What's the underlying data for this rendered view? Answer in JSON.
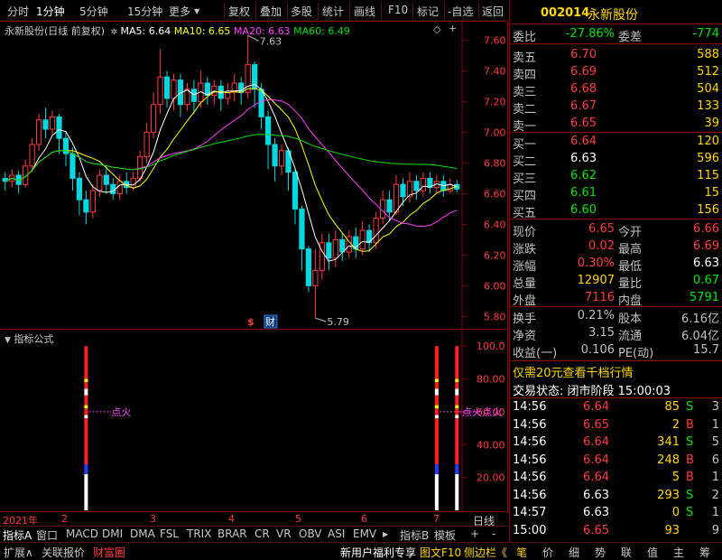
{
  "toolbar": {
    "left": [
      "分时",
      "1分钟",
      "5分钟",
      "15分钟",
      "更多"
    ],
    "more_icon": "chevron-down-icon",
    "right": [
      "复权",
      "叠加",
      "多股",
      "统计",
      "画线",
      "F10",
      "标记",
      "-自选",
      "返回"
    ]
  },
  "chart_header": {
    "title": "永新股份(日线 前复权)",
    "ma5": "MA5: 6.64",
    "ma10": "MA10: 6.65",
    "ma20": "MA20: 6.63",
    "ma60": "MA60: 6.49"
  },
  "colors": {
    "up": "#ff3c3c",
    "down": "#00d8e0",
    "ma5": "#ffffff",
    "ma10": "#ffff00",
    "ma20": "#ff40ff",
    "ma60": "#00e000",
    "border": "#8b0000"
  },
  "chart_data": [
    {
      "type": "candlestick",
      "ylim": [
        5.72,
        7.72
      ],
      "yticks": [
        "7.60",
        "7.40",
        "7.20",
        "7.00",
        "6.80",
        "6.60",
        "6.40",
        "6.20",
        "6.00",
        "5.80"
      ],
      "ytick_values": [
        7.6,
        7.4,
        7.2,
        7.0,
        6.8,
        6.6,
        6.4,
        6.2,
        6.0,
        5.8
      ],
      "annotations": {
        "high": "7.63",
        "low": "5.79",
        "high_value": 7.63,
        "low_value": 5.79
      },
      "markers": [
        "$",
        "财"
      ],
      "candles": [
        [
          6.7,
          6.68,
          6.74,
          6.62
        ],
        [
          6.68,
          6.72,
          6.76,
          6.64
        ],
        [
          6.72,
          6.66,
          6.75,
          6.6
        ],
        [
          6.66,
          6.78,
          6.82,
          6.64
        ],
        [
          6.78,
          6.92,
          6.96,
          6.74
        ],
        [
          6.92,
          7.08,
          7.12,
          6.88
        ],
        [
          7.08,
          7.02,
          7.16,
          6.96
        ],
        [
          7.02,
          7.1,
          7.14,
          6.98
        ],
        [
          7.1,
          6.96,
          7.12,
          6.86
        ],
        [
          6.96,
          6.86,
          7.0,
          6.78
        ],
        [
          6.86,
          6.7,
          6.9,
          6.62
        ],
        [
          6.7,
          6.56,
          6.74,
          6.46
        ],
        [
          6.56,
          6.48,
          6.62,
          6.4
        ],
        [
          6.48,
          6.62,
          6.66,
          6.44
        ],
        [
          6.62,
          6.72,
          6.76,
          6.58
        ],
        [
          6.72,
          6.66,
          6.78,
          6.6
        ],
        [
          6.66,
          6.6,
          6.7,
          6.56
        ],
        [
          6.6,
          6.68,
          6.72,
          6.56
        ],
        [
          6.68,
          6.64,
          6.74,
          6.6
        ],
        [
          6.64,
          6.7,
          6.74,
          6.62
        ],
        [
          6.7,
          6.84,
          6.88,
          6.68
        ],
        [
          6.84,
          7.0,
          7.06,
          6.8
        ],
        [
          7.0,
          7.18,
          7.26,
          6.96
        ],
        [
          7.18,
          7.36,
          7.54,
          7.12
        ],
        [
          7.36,
          7.22,
          7.4,
          7.16
        ],
        [
          7.22,
          7.34,
          7.38,
          7.14
        ],
        [
          7.34,
          7.18,
          7.38,
          7.1
        ],
        [
          7.18,
          7.28,
          7.32,
          7.14
        ],
        [
          7.28,
          7.2,
          7.34,
          7.12
        ],
        [
          7.2,
          7.32,
          7.4,
          7.16
        ],
        [
          7.32,
          7.24,
          7.36,
          7.18
        ],
        [
          7.24,
          7.3,
          7.34,
          7.18
        ],
        [
          7.3,
          7.22,
          7.34,
          7.14
        ],
        [
          7.22,
          7.26,
          7.32,
          7.18
        ],
        [
          7.26,
          7.32,
          7.38,
          7.2
        ],
        [
          7.32,
          7.26,
          7.36,
          7.18
        ],
        [
          7.26,
          7.44,
          7.63,
          7.22
        ],
        [
          7.44,
          7.28,
          7.46,
          7.16
        ],
        [
          7.28,
          7.1,
          7.32,
          7.02
        ],
        [
          7.1,
          6.92,
          7.14,
          6.76
        ],
        [
          6.92,
          6.78,
          6.96,
          6.68
        ],
        [
          6.78,
          6.88,
          6.92,
          6.72
        ],
        [
          6.88,
          6.74,
          6.9,
          6.62
        ],
        [
          6.74,
          6.5,
          6.76,
          6.4
        ],
        [
          6.5,
          6.24,
          6.52,
          6.1
        ],
        [
          6.24,
          6.0,
          6.26,
          5.96
        ],
        [
          6.0,
          6.1,
          6.24,
          5.79
        ],
        [
          6.1,
          6.28,
          6.34,
          6.04
        ],
        [
          6.28,
          6.18,
          6.34,
          6.1
        ],
        [
          6.18,
          6.3,
          6.36,
          6.12
        ],
        [
          6.3,
          6.22,
          6.34,
          6.16
        ],
        [
          6.22,
          6.32,
          6.36,
          6.18
        ],
        [
          6.32,
          6.24,
          6.38,
          6.18
        ],
        [
          6.24,
          6.36,
          6.42,
          6.2
        ],
        [
          6.36,
          6.28,
          6.4,
          6.22
        ],
        [
          6.28,
          6.44,
          6.48,
          6.24
        ],
        [
          6.44,
          6.56,
          6.62,
          6.4
        ],
        [
          6.56,
          6.48,
          6.62,
          6.42
        ],
        [
          6.48,
          6.66,
          6.72,
          6.46
        ],
        [
          6.66,
          6.58,
          6.7,
          6.52
        ],
        [
          6.58,
          6.68,
          6.74,
          6.54
        ],
        [
          6.68,
          6.62,
          6.72,
          6.56
        ],
        [
          6.62,
          6.7,
          6.74,
          6.58
        ],
        [
          6.7,
          6.64,
          6.74,
          6.6
        ],
        [
          6.64,
          6.68,
          6.72,
          6.6
        ],
        [
          6.68,
          6.62,
          6.72,
          6.58
        ],
        [
          6.62,
          6.66,
          6.7,
          6.6
        ],
        [
          6.66,
          6.63,
          6.69,
          6.61
        ]
      ]
    },
    {
      "type": "bar",
      "title": "指标公式",
      "ylim": [
        0,
        110
      ],
      "yticks": [
        "100.0",
        "80.00",
        "60.00",
        "40.00",
        "20.00"
      ],
      "ytick_values": [
        100,
        80,
        60,
        40,
        20
      ],
      "signal_label": "点火",
      "signals": [
        {
          "index": 12,
          "value": 100,
          "label": "点火"
        },
        {
          "index": 64,
          "value": 100,
          "label": "点火"
        },
        {
          "index": 67,
          "value": 100,
          "label": "点火"
        }
      ],
      "signal_label_level": 60
    }
  ],
  "date_axis": {
    "year": "2021年",
    "months": [
      "2",
      "3",
      "4",
      "5",
      "6",
      "7"
    ],
    "right_label": "日线"
  },
  "tabs": [
    "指标A",
    "窗口",
    "MACD",
    "DMI",
    "DMA",
    "FSL",
    "TRIX",
    "BRAR",
    "CR",
    "VR",
    "OBV",
    "ASI",
    "EMV"
  ],
  "tabs_right": [
    "指标B",
    "模板",
    "+",
    "-"
  ],
  "status_left": [
    "扩展∧",
    "关联报价",
    "财富圈"
  ],
  "status_mid": [
    "新用户福利专享",
    "图文F10",
    "侧边栏《"
  ],
  "status_right": [
    "笔",
    "价",
    "细",
    "势",
    "联",
    "值",
    "主",
    "筹"
  ],
  "quote": {
    "code": "002014",
    "name": "永新股份",
    "weibi_label": "委比",
    "weibi": "-27.86%",
    "weicha_label": "委差",
    "weicha": "-774",
    "asks": [
      {
        "label": "卖五",
        "price": "6.70",
        "vol": "588"
      },
      {
        "label": "卖四",
        "price": "6.69",
        "vol": "512"
      },
      {
        "label": "卖三",
        "price": "6.68",
        "vol": "504"
      },
      {
        "label": "卖二",
        "price": "6.67",
        "vol": "133"
      },
      {
        "label": "卖一",
        "price": "6.65",
        "vol": "39"
      }
    ],
    "bids": [
      {
        "label": "买一",
        "price": "6.64",
        "vol": "120"
      },
      {
        "label": "买二",
        "price": "6.63",
        "vol": "596"
      },
      {
        "label": "买三",
        "price": "6.62",
        "vol": "115"
      },
      {
        "label": "买四",
        "price": "6.61",
        "vol": "15"
      },
      {
        "label": "买五",
        "price": "6.60",
        "vol": "156"
      }
    ],
    "stats": [
      {
        "l1": "现价",
        "v1": "6.65",
        "l2": "今开",
        "v2": "6.66"
      },
      {
        "l1": "涨跌",
        "v1": "0.02",
        "l2": "最高",
        "v2": "6.69"
      },
      {
        "l1": "涨幅",
        "v1": "0.30%",
        "l2": "最低",
        "v2": "6.63"
      },
      {
        "l1": "总量",
        "v1": "12907",
        "l2": "量比",
        "v2": "0.67"
      },
      {
        "l1": "外盘",
        "v1": "7116",
        "l2": "内盘",
        "v2": "5791"
      }
    ],
    "stats2": [
      {
        "l1": "换手",
        "v1": "0.21%",
        "l2": "股本",
        "v2": "6.16亿"
      },
      {
        "l1": "净资",
        "v1": "3.15",
        "l2": "流通",
        "v2": "6.04亿"
      },
      {
        "l1": "收益(一)",
        "v1": "0.106",
        "l2": "PE(动)",
        "v2": "15.7"
      }
    ],
    "promo": "仅需20元查看千档行情",
    "trade_status": "交易状态: 闭市阶段 15:00:03",
    "ticks": [
      {
        "t": "14:56",
        "p": "6.64",
        "v": "85",
        "s": "S",
        "n": "3"
      },
      {
        "t": "14:56",
        "p": "6.65",
        "v": "2",
        "s": "B",
        "n": "1"
      },
      {
        "t": "14:56",
        "p": "6.64",
        "v": "341",
        "s": "S",
        "n": "5"
      },
      {
        "t": "14:56",
        "p": "6.64",
        "v": "248",
        "s": "B",
        "n": "6"
      },
      {
        "t": "14:56",
        "p": "6.64",
        "v": "5",
        "s": "B",
        "n": "1"
      },
      {
        "t": "14:56",
        "p": "6.63",
        "v": "293",
        "s": "S",
        "n": "2"
      },
      {
        "t": "14:57",
        "p": "6.63",
        "v": "0",
        "s": "S",
        "n": "1"
      },
      {
        "t": "15:00",
        "p": "6.65",
        "v": "93",
        "s": "",
        "n": "9"
      }
    ]
  }
}
